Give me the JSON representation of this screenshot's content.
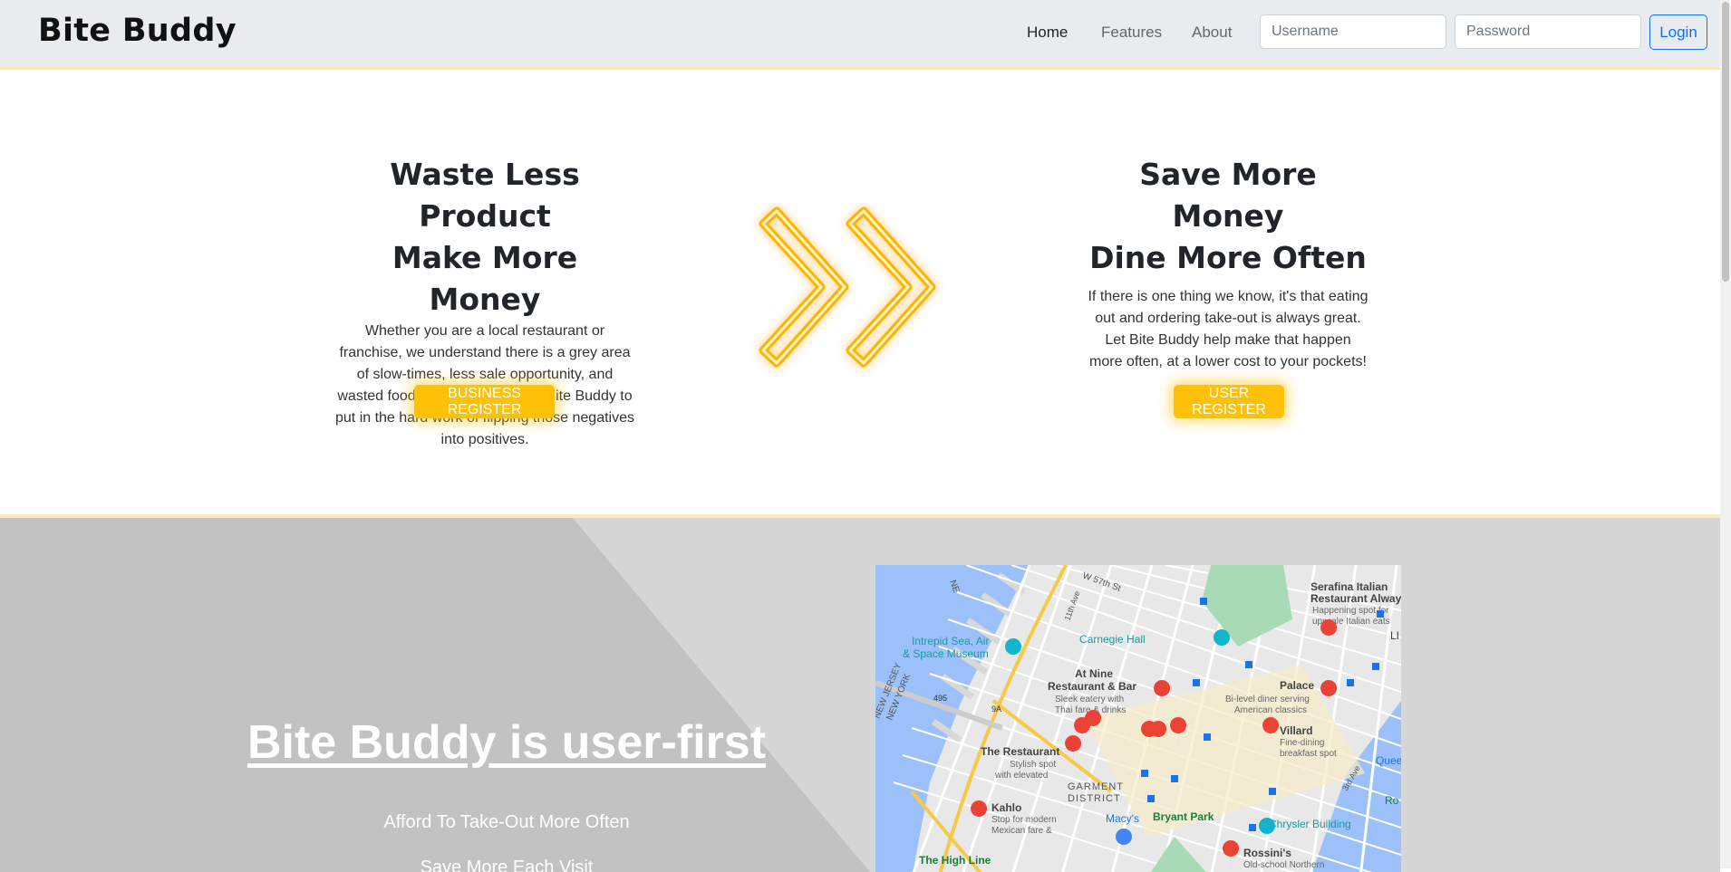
{
  "nav": {
    "brand": "Bite Buddy",
    "links": [
      "Home",
      "Features",
      "About"
    ],
    "username_placeholder": "Username",
    "password_placeholder": "Password",
    "login_label": "Login"
  },
  "hero": {
    "left": {
      "title_line1": "Waste Less Product",
      "title_line2": "Make More Money",
      "body": "Whether you are a local restaurant or franchise, we understand there is a grey area of slow-times, less sale opportunity, and wasted food. Take advantage of Bite Buddy to put in the hard work of flipping those negatives into positives.",
      "button": "BUSINESS REGISTER"
    },
    "right": {
      "title_line1": "Save More Money",
      "title_line2": "Dine More Often",
      "body": "If there is one thing we know, it's that eating out and ordering take-out is always great. Let Bite Buddy help make that happen more often, at a lower cost to your pockets!",
      "button": "USER REGISTER"
    }
  },
  "section2": {
    "heading": "Bite Buddy is user-first",
    "line1": "Afford To Take-Out More Often",
    "line2": "Save More Each Visit"
  },
  "map": {
    "labels": {
      "intrepid": "Intrepid Sea, Air",
      "intrepid2": "& Space Museum",
      "carnegie": "Carnegie Hall",
      "serafina1": "Serafina Italian",
      "serafina2": "Restaurant Always",
      "serafina3": "Happening spot for",
      "serafina4": "upscale Italian eats",
      "atnine1": "At Nine",
      "atnine2": "Restaurant & Bar",
      "atnine3": "Sleek eatery with",
      "atnine4": "Thai fare & drinks",
      "palace1": "Palace",
      "palace2": "Bi-level diner serving",
      "palace3": "American classics",
      "villard1": "Villard",
      "villard2": "Fine-dining",
      "villard3": "breakfast spot",
      "therest1": "The Restaurant",
      "therest2": "Stylish spot",
      "therest3": "with elevated",
      "garment1": "GARMENT",
      "garment2": "DISTRICT",
      "kahlo1": "Kahlo",
      "kahlo2": "Stop for modern",
      "kahlo3": "Mexican fare &",
      "macys": "Macy's",
      "bryant": "Bryant Park",
      "chrysler": "Chrysler Building",
      "highline": "The High Line",
      "rossini1": "Rossini's",
      "rossini2": "Old-school Northern",
      "queens": "Queen",
      "newjersey": "NEW JERSEY",
      "newyork": "NEW YORK",
      "w57": "W 57th St",
      "eleventh": "11th Ave",
      "third": "3rd Ave",
      "r495": "495",
      "r9a": "9A",
      "ne": "NE",
      "li": "LI",
      "ro": "Ro"
    }
  },
  "colors": {
    "accent": "#ffc107",
    "login_blue": "#0d6efd",
    "section2_bg": "#d6d6d6",
    "section2_triangle": "#c2c2c2"
  }
}
